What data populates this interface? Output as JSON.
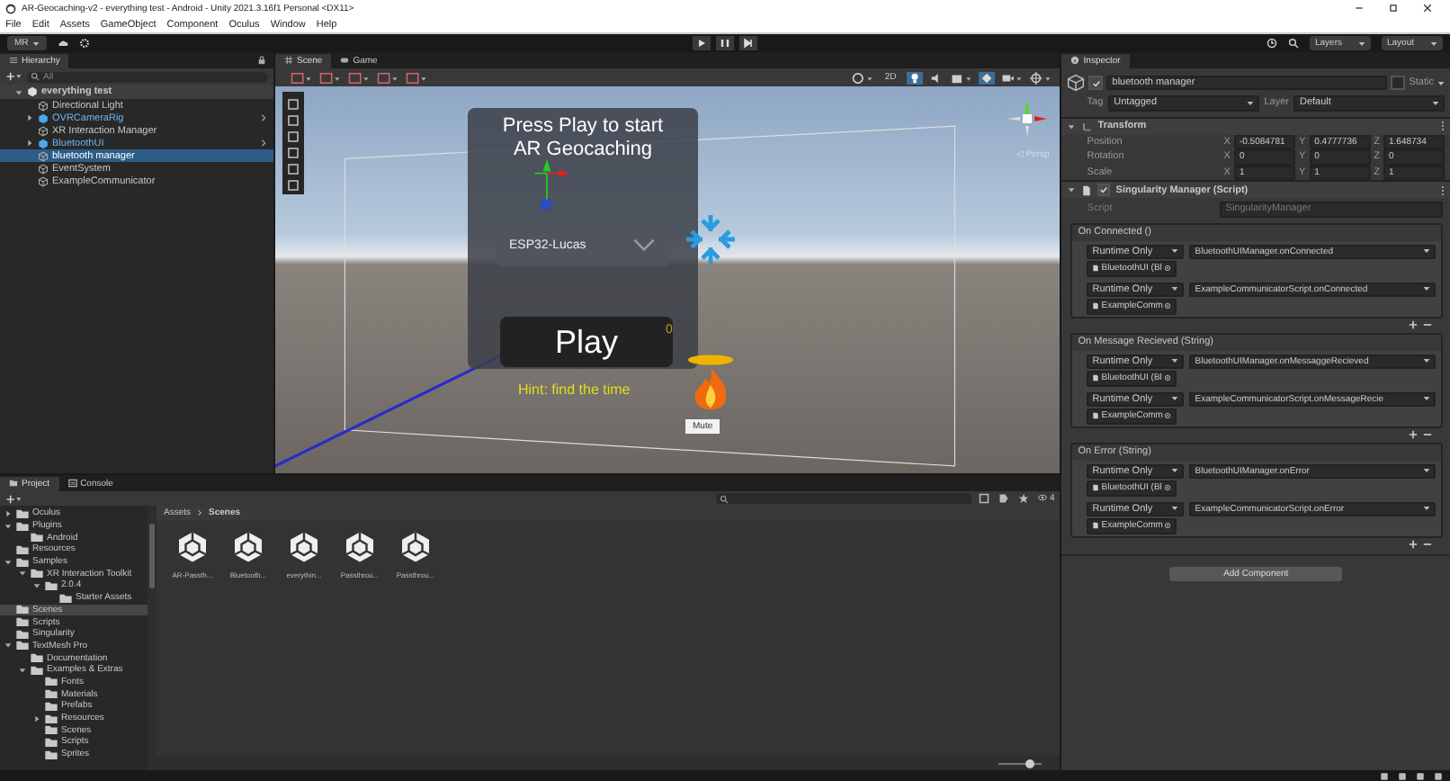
{
  "window": {
    "title": "AR-Geocaching-v2 - everything test - Android - Unity 2021.3.16f1 Personal <DX11>"
  },
  "menu": [
    "File",
    "Edit",
    "Assets",
    "GameObject",
    "Component",
    "Oculus",
    "Window",
    "Help"
  ],
  "toolbar": {
    "account": "MR",
    "layers": "Layers",
    "layout": "Layout"
  },
  "hierarchy": {
    "title": "Hierarchy",
    "search_placeholder": "All",
    "scene": "everything test",
    "items": [
      {
        "label": "Directional Light",
        "kind": "object",
        "selected": false
      },
      {
        "label": "OVRCameraRig",
        "kind": "prefab",
        "selected": false
      },
      {
        "label": "XR Interaction Manager",
        "kind": "object",
        "selected": false
      },
      {
        "label": "BluetoothUI",
        "kind": "prefab",
        "selected": false
      },
      {
        "label": "bluetooth manager",
        "kind": "object",
        "selected": true
      },
      {
        "label": "EventSystem",
        "kind": "object",
        "selected": false
      },
      {
        "label": "ExampleCommunicator",
        "kind": "object",
        "selected": false
      }
    ]
  },
  "scene_view": {
    "tabs": [
      {
        "label": "Scene",
        "selected": true
      },
      {
        "label": "Game",
        "selected": false
      }
    ],
    "mode_2d": "2D",
    "lighting": true,
    "persp": "◁ Persp",
    "panel": {
      "title": "Press Play to start AR Geocaching",
      "dropdown": "ESP32-Lucas",
      "play": "Play",
      "counter": "0",
      "hint": "Hint: find the time",
      "mute": "Mute"
    }
  },
  "project": {
    "zoom": {
      "level": 0.7
    },
    "tabs": [
      {
        "label": "Project",
        "selected": true
      },
      {
        "label": "Console",
        "selected": false
      }
    ],
    "hidden_count": "4",
    "tree": [
      {
        "label": "Oculus",
        "expanded": false,
        "selected": false
      },
      {
        "label": "Plugins",
        "expanded": true,
        "selected": false,
        "children": [
          {
            "label": "Android",
            "selected": false
          }
        ]
      },
      {
        "label": "Resources",
        "selected": false
      },
      {
        "label": "Samples",
        "expanded": true,
        "selected": false,
        "children": [
          {
            "label": "XR Interaction Toolkit",
            "expanded": true,
            "selected": false,
            "children": [
              {
                "label": "2.0.4",
                "expanded": true,
                "selected": false,
                "children": [
                  {
                    "label": "Starter Assets",
                    "selected": false
                  }
                ]
              }
            ]
          }
        ]
      },
      {
        "label": "Scenes",
        "selected": true
      },
      {
        "label": "Scripts",
        "selected": false
      },
      {
        "label": "Singularity",
        "selected": false
      },
      {
        "label": "TextMesh Pro",
        "expanded": true,
        "selected": false,
        "children": [
          {
            "label": "Documentation",
            "selected": false
          },
          {
            "label": "Examples & Extras",
            "expanded": true,
            "selected": false,
            "children": [
              {
                "label": "Fonts",
                "selected": false
              },
              {
                "label": "Materials",
                "selected": false
              },
              {
                "label": "Prefabs",
                "selected": false
              },
              {
                "label": "Resources",
                "expanded": false,
                "selected": false
              },
              {
                "label": "Scenes",
                "selected": false
              },
              {
                "label": "Scripts",
                "selected": false
              },
              {
                "label": "Sprites",
                "selected": false
              }
            ]
          }
        ]
      }
    ],
    "breadcrumb": [
      "Assets",
      "Scenes"
    ],
    "assets": [
      "AR-Passth...",
      "Bluetooth...",
      "everythin...",
      "Passthrou...",
      "Passthrou..."
    ]
  },
  "inspector": {
    "title": "Inspector",
    "name": "bluetooth manager",
    "active": true,
    "static_label": "Static",
    "static": false,
    "tag_label": "Tag",
    "tag": "Untagged",
    "layer_label": "Layer",
    "layer": "Default",
    "transform": {
      "title": "Transform",
      "rows": [
        {
          "label": "Position",
          "values": [
            {
              "axis": "X",
              "value": "-0.5084781"
            },
            {
              "axis": "Y",
              "value": "0.4777736"
            },
            {
              "axis": "Z",
              "value": "1.648734"
            }
          ]
        },
        {
          "label": "Rotation",
          "values": [
            {
              "axis": "X",
              "value": "0"
            },
            {
              "axis": "Y",
              "value": "0"
            },
            {
              "axis": "Z",
              "value": "0"
            }
          ]
        },
        {
          "label": "Scale",
          "values": [
            {
              "axis": "X",
              "value": "1"
            },
            {
              "axis": "Y",
              "value": "1"
            },
            {
              "axis": "Z",
              "value": "1"
            }
          ]
        }
      ]
    },
    "script_component": {
      "title": "Singularity Manager (Script)",
      "enabled": true,
      "script_label": "Script",
      "script": "SingularityManager",
      "events": [
        {
          "title": "On Connected ()",
          "listeners": [
            {
              "mode": "Runtime Only",
              "function": "BluetoothUIManager.onConnected",
              "target": "BluetoothUI (Bl"
            },
            {
              "mode": "Runtime Only",
              "function": "ExampleCommunicatorScript.onConnected",
              "target": "ExampleComm"
            }
          ]
        },
        {
          "title": "On Message Recieved (String)",
          "listeners": [
            {
              "mode": "Runtime Only",
              "function": "BluetoothUIManager.onMessaggeRecieved",
              "target": "BluetoothUI (Bl"
            },
            {
              "mode": "Runtime Only",
              "function": "ExampleCommunicatorScript.onMessageRecie",
              "target": "ExampleComm"
            }
          ]
        },
        {
          "title": "On Error (String)",
          "listeners": [
            {
              "mode": "Runtime Only",
              "function": "BluetoothUIManager.onError",
              "target": "BluetoothUI (Bl"
            },
            {
              "mode": "Runtime Only",
              "function": "ExampleCommunicatorScript.onError",
              "target": "ExampleComm"
            }
          ]
        }
      ]
    },
    "add_component": "Add Component"
  }
}
